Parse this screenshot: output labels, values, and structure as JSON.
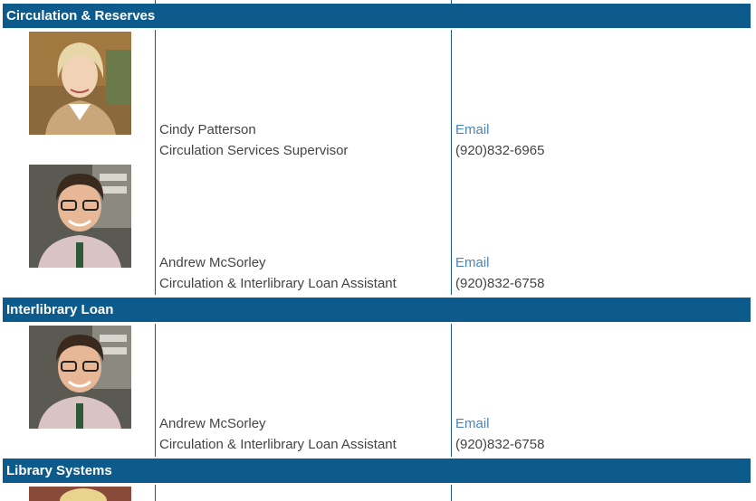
{
  "sections": [
    {
      "title": "Circulation & Reserves",
      "staff": [
        {
          "name": "Cindy Patterson",
          "role": "Circulation Services Supervisor",
          "email_label": "Email",
          "phone": "(920)832-6965"
        },
        {
          "name": "Andrew McSorley",
          "role": "Circulation & Interlibrary Loan Assistant",
          "email_label": "Email",
          "phone": "(920)832-6758"
        }
      ]
    },
    {
      "title": "Interlibrary Loan",
      "staff": [
        {
          "name": "Andrew McSorley",
          "role": "Circulation & Interlibrary Loan Assistant",
          "email_label": "Email",
          "phone": "(920)832-6758"
        }
      ]
    },
    {
      "title": "Library Systems",
      "staff": []
    }
  ],
  "colors": {
    "header_bg": "#0d5a8c",
    "link": "#4a86bd",
    "text": "#444444"
  },
  "icons": [
    "staff-photo-woman",
    "staff-photo-man"
  ]
}
